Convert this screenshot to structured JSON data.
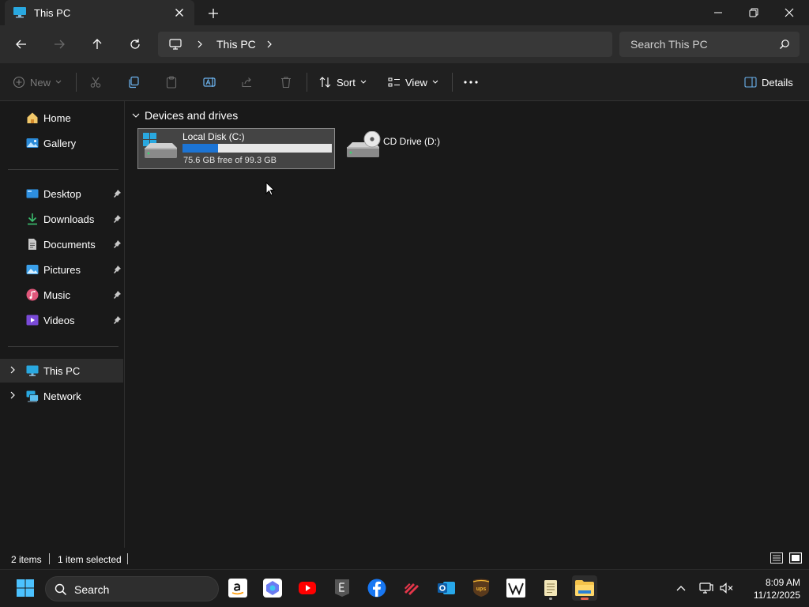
{
  "window": {
    "tab_title": "This PC",
    "minimize_icon": "minimize-icon",
    "restore_icon": "restore-icon",
    "close_icon": "close-icon"
  },
  "address_bar": {
    "location": "This PC"
  },
  "search": {
    "placeholder": "Search This PC"
  },
  "command_bar": {
    "new_label": "New",
    "sort_label": "Sort",
    "view_label": "View",
    "details_label": "Details"
  },
  "sidebar": {
    "items": [
      {
        "label": "Home",
        "icon": "home-icon"
      },
      {
        "label": "Gallery",
        "icon": "gallery-icon"
      },
      {
        "label": "Desktop",
        "icon": "desktop-icon",
        "pinned": true
      },
      {
        "label": "Downloads",
        "icon": "downloads-icon",
        "pinned": true
      },
      {
        "label": "Documents",
        "icon": "documents-icon",
        "pinned": true
      },
      {
        "label": "Pictures",
        "icon": "pictures-icon",
        "pinned": true
      },
      {
        "label": "Music",
        "icon": "music-icon",
        "pinned": true
      },
      {
        "label": "Videos",
        "icon": "videos-icon",
        "pinned": true
      },
      {
        "label": "This PC",
        "icon": "this-pc-icon",
        "selected": true
      },
      {
        "label": "Network",
        "icon": "network-icon"
      }
    ]
  },
  "content": {
    "group_title": "Devices and drives",
    "drives": [
      {
        "name": "Local Disk (C:)",
        "free_text": "75.6 GB free of 99.3 GB",
        "used_fraction": 0.24,
        "selected": true
      },
      {
        "name": "CD Drive (D:)"
      }
    ]
  },
  "status_bar": {
    "item_count": "2 items",
    "selection": "1 item selected"
  },
  "taskbar": {
    "search_label": "Search",
    "apps": [
      "amazon",
      "copilot",
      "youtube",
      "epic-games",
      "facebook",
      "app",
      "outlook",
      "ups",
      "wikipedia",
      "notepad",
      "file-explorer"
    ]
  },
  "clock": {
    "time": "8:09 AM",
    "date": "11/12/2025"
  },
  "colors": {
    "accent": "#1c74d4",
    "background": "#191919",
    "selection": "#444444"
  }
}
